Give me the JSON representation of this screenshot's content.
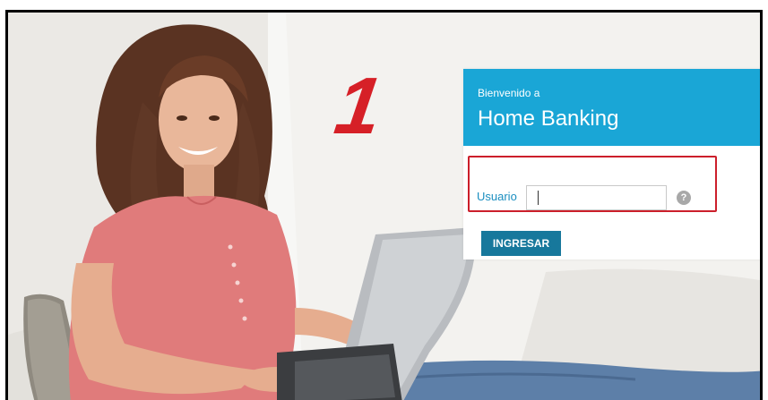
{
  "step": {
    "number": "1"
  },
  "login": {
    "welcome": "Bienvenido a",
    "title": "Home Banking",
    "user_label": "Usuario",
    "user_value": "",
    "help_symbol": "?",
    "submit_label": "INGRESAR"
  },
  "colors": {
    "header_bg": "#1aa6d6",
    "button_bg": "#17789c",
    "highlight_border": "#cc1f2b",
    "step_number": "#d62027",
    "label_text": "#1a8ec0"
  },
  "icons": {
    "help": "question-circle-icon"
  }
}
